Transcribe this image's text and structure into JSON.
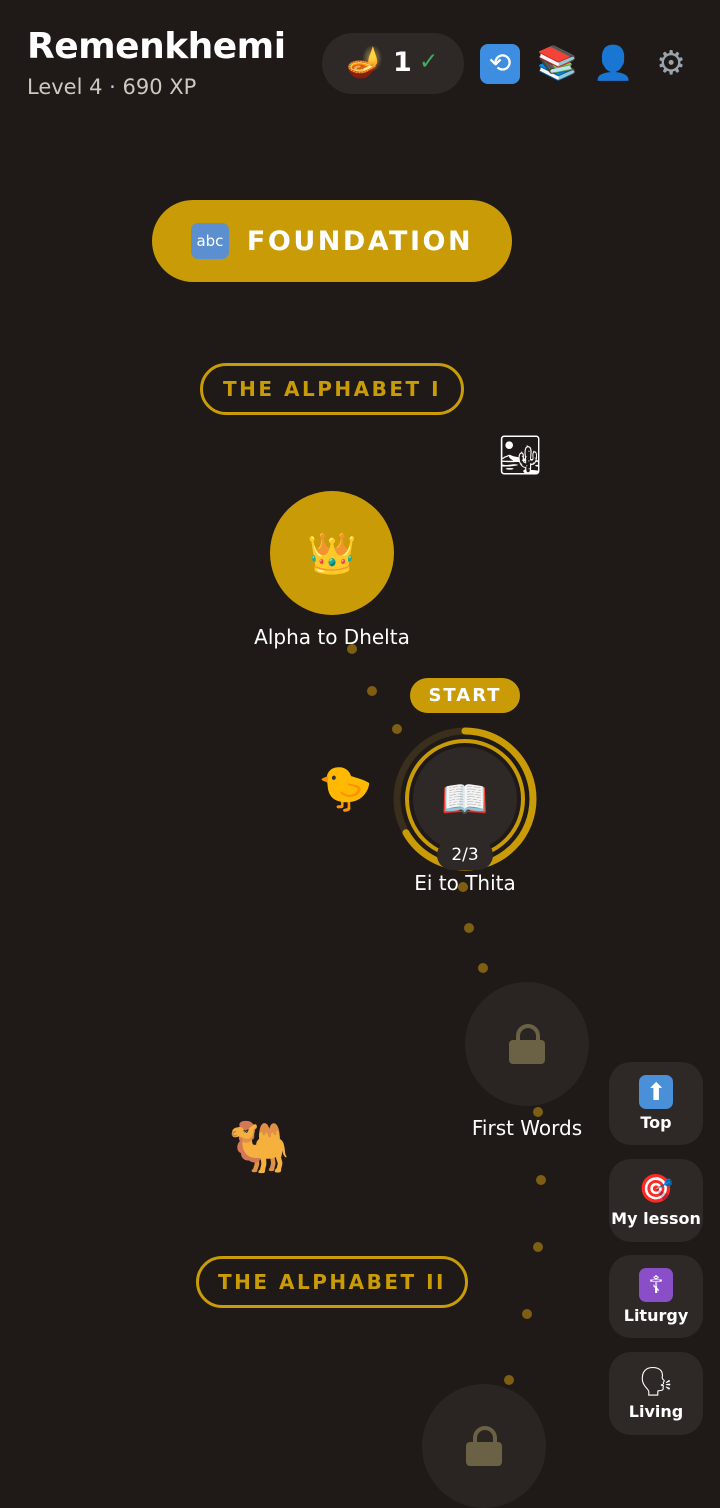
{
  "header": {
    "title": "Remenkhemi",
    "subtitle": "Level 4 · 690 XP",
    "streak": {
      "icon": "oil-lamp-icon",
      "glyph": "🪔",
      "count": "1",
      "check": "✓"
    },
    "icons": [
      {
        "name": "refresh-icon",
        "glyph": "🔁"
      },
      {
        "name": "books-icon",
        "glyph": "📚"
      },
      {
        "name": "profile-icon",
        "glyph": "👤"
      },
      {
        "name": "settings-icon",
        "glyph": "⚙"
      }
    ]
  },
  "unit": {
    "icon_text": "abc",
    "label": "FOUNDATION"
  },
  "sections": [
    {
      "label": "THE ALPHABET I"
    },
    {
      "label": "THE ALPHABET II"
    }
  ],
  "lessons": [
    {
      "label": "Alpha to Dhelta",
      "status": "completed",
      "icon": "👑"
    },
    {
      "label": "Ei to Thita",
      "status": "current",
      "icon": "📖",
      "start_label": "START",
      "progress": "2/3",
      "progress_fraction": 0.667
    },
    {
      "label": "First Words",
      "status": "locked"
    },
    {
      "label": "",
      "status": "locked"
    }
  ],
  "mascots": {
    "desert": "🏜",
    "chick": "🐤",
    "camel": "🐫"
  },
  "side_buttons": [
    {
      "label": "Top",
      "icon": "⬆"
    },
    {
      "label": "My lesson",
      "icon": "🎯"
    },
    {
      "label": "Liturgy",
      "icon": "☦"
    },
    {
      "label": "Living",
      "icon": "🗣"
    }
  ],
  "colors": {
    "accent": "#c99b07",
    "background": "#1f1a17",
    "surface": "#2e2926",
    "path_dot": "#7d5e12"
  }
}
